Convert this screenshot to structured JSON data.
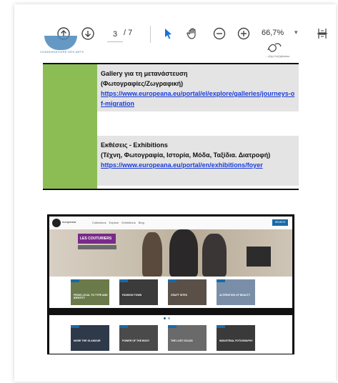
{
  "toolbar": {
    "current_page": "3",
    "page_total": "/ 7",
    "zoom_level": "66,7%",
    "zoom_caret": "▾",
    "icons": [
      "arrow-up-icon",
      "arrow-down-icon",
      "select-cursor-icon",
      "hand-pan-icon",
      "zoom-out-icon",
      "zoom-in-icon",
      "fit-page-icon"
    ]
  },
  "header": {
    "logo_left_text": "CONSERVATOIRE DES ARTS",
    "logo_right_text": "...εξης Κοζυβασιου"
  },
  "table": {
    "row1": {
      "title": "Gallery για τη μετανάστευση",
      "subtitle": "(Φωτογραφίες/Ζωγραφική)",
      "link": "https://www.europeana.eu/portal/el/explore/galleries/journeys-of-migration"
    },
    "row2": {
      "title": "Εκθέσεις - Exhibitions",
      "subtitle": "(Τέχνη, Φωτογραφία, Ιστορία, Μόδα, Ταξίδια. Διατροφή)",
      "link": "https://www.europeana.eu/portal/en/exhibitions/foyer"
    }
  },
  "screenshot": {
    "logo_text": "europeana",
    "menu": "Collections Explore Exhibitions Blog",
    "cta": "SEARCH",
    "hero_label": "LES COUTURIERS",
    "row1_labels": [
      "FROM LOCAL TO TYPE AND IDENTITY",
      "FASHION TOWN",
      "CRAFT SITES",
      "ALTERATION OF BEAUTY"
    ],
    "row2_labels": [
      "MORE THE GLAMOUR",
      "POWER OF THE BODY",
      "THE LOST GOLDS",
      "INDUSTRIAL FOTOGRAPHY"
    ]
  },
  "colors": {
    "green_band": "#8cbd55",
    "link_blue": "#1a3cd8",
    "cursor_blue": "#1673d8"
  }
}
